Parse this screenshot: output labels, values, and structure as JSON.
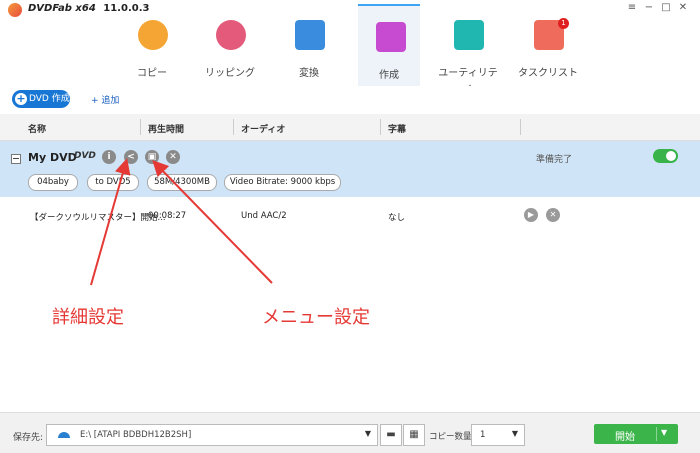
{
  "app": {
    "name": "DVDFab x64",
    "version": "11.0.0.3"
  },
  "window_controls": [
    "≡",
    "−",
    "□",
    "✕"
  ],
  "tabs": [
    {
      "label": "コピー",
      "icon": "copy-disc-icon",
      "color": "#f4a534"
    },
    {
      "label": "リッピング",
      "icon": "ripper-disc-icon",
      "color": "#e35a7a"
    },
    {
      "label": "変換",
      "icon": "converter-film-icon",
      "color": "#3a8dde"
    },
    {
      "label": "作成",
      "icon": "creator-icon",
      "color": "#c64bd0",
      "active": true
    },
    {
      "label": "ユーティリティ",
      "icon": "utility-puzzle-icon",
      "color": "#1fb7b0"
    },
    {
      "label": "タスクリスト",
      "icon": "tasklist-icon",
      "color": "#ef6b5b",
      "badge": "1"
    }
  ],
  "toolbar": {
    "create_label": "DVD 作成",
    "add_label": "+ 追加"
  },
  "columns": [
    "名称",
    "再生時間",
    "オーディオ",
    "字幕"
  ],
  "dvd": {
    "title": "My DVD",
    "logo": "DVD",
    "status": "準備完了",
    "pills": [
      "04baby",
      "to DVD5",
      "58M/4300MB",
      "Video Bitrate: 9000 kbps"
    ]
  },
  "track": {
    "name": "【ダークソウルリマスター】開始...",
    "duration": "00:08:27",
    "audio": "Und AAC/2",
    "subtitle": "なし"
  },
  "annotations": {
    "detail": "詳細設定",
    "menu": "メニュー設定"
  },
  "bottom": {
    "save_label": "保存先:",
    "save_value": "E:\\ [ATAPI BDBDH12B2SH]",
    "copy_count_label": "コピー数量:",
    "copy_count_value": "1",
    "start_label": "開始"
  },
  "colors": {
    "accent": "#1877d5",
    "selected_row": "#cfe4f6",
    "start": "#3bb54a",
    "annotation": "#e53935"
  }
}
